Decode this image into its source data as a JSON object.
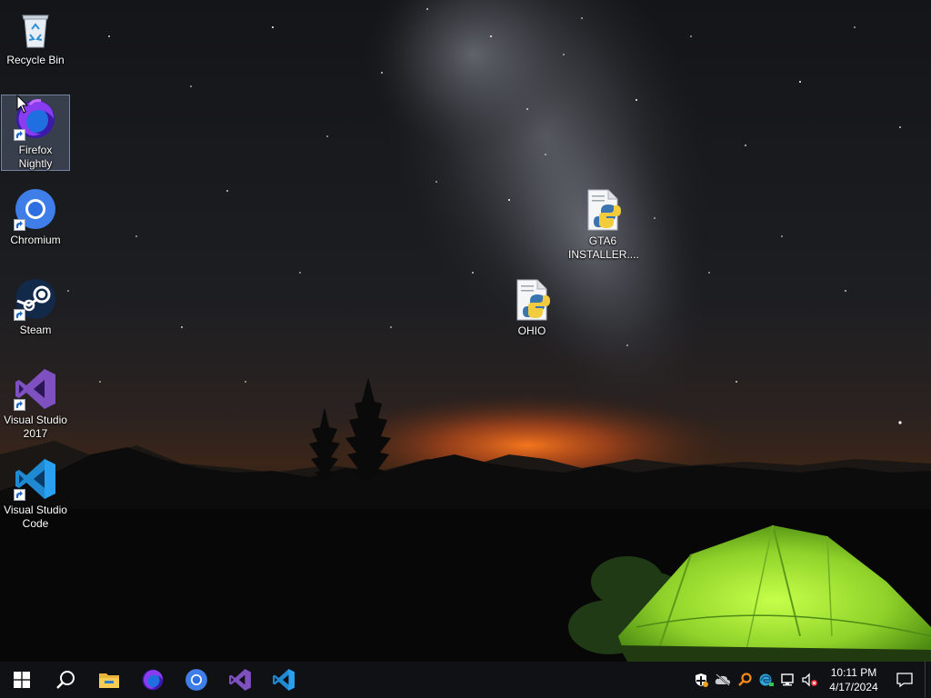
{
  "desktop": {
    "icons": [
      {
        "id": "recycle-bin",
        "label": "Recycle Bin",
        "icon": "recycle-bin-icon",
        "shortcut": false,
        "selected": false
      },
      {
        "id": "firefox-nightly",
        "label": "Firefox\nNightly",
        "icon": "firefox-nightly-icon",
        "shortcut": true,
        "selected": true
      },
      {
        "id": "chromium",
        "label": "Chromium",
        "icon": "chromium-icon",
        "shortcut": true,
        "selected": false
      },
      {
        "id": "steam",
        "label": "Steam",
        "icon": "steam-icon",
        "shortcut": true,
        "selected": false
      },
      {
        "id": "visual-studio-2017",
        "label": "Visual Studio\n2017",
        "icon": "visual-studio-icon",
        "shortcut": true,
        "selected": false
      },
      {
        "id": "visual-studio-code",
        "label": "Visual Studio\nCode",
        "icon": "vscode-icon",
        "shortcut": true,
        "selected": false
      },
      {
        "id": "gta6-installer",
        "label": "GTA6\nINSTALLER....",
        "icon": "python-file-icon",
        "shortcut": false,
        "selected": false
      },
      {
        "id": "ohio",
        "label": "OHIO",
        "icon": "python-file-icon",
        "shortcut": false,
        "selected": false
      }
    ]
  },
  "taskbar": {
    "buttons": [
      {
        "id": "start",
        "icon": "windows-start-icon"
      },
      {
        "id": "search",
        "icon": "search-icon"
      },
      {
        "id": "file-explorer",
        "icon": "file-explorer-icon"
      },
      {
        "id": "firefox-nightly",
        "icon": "firefox-nightly-icon"
      },
      {
        "id": "chromium",
        "icon": "chromium-icon"
      },
      {
        "id": "visual-studio",
        "icon": "visual-studio-icon"
      },
      {
        "id": "vscode",
        "icon": "vscode-icon"
      }
    ],
    "tray": {
      "icons": [
        "security-shield-icon",
        "onedrive-offline-icon",
        "search-orange-icon",
        "edge-update-icon",
        "network-icon",
        "volume-muted-icon"
      ],
      "time": "10:11 PM",
      "date": "4/17/2024"
    }
  },
  "colors": {
    "taskbar_bg": "#101114",
    "accent": "#76b9ed",
    "tent_green": "#9be22a",
    "horizon_orange": "#ff6a1a"
  }
}
